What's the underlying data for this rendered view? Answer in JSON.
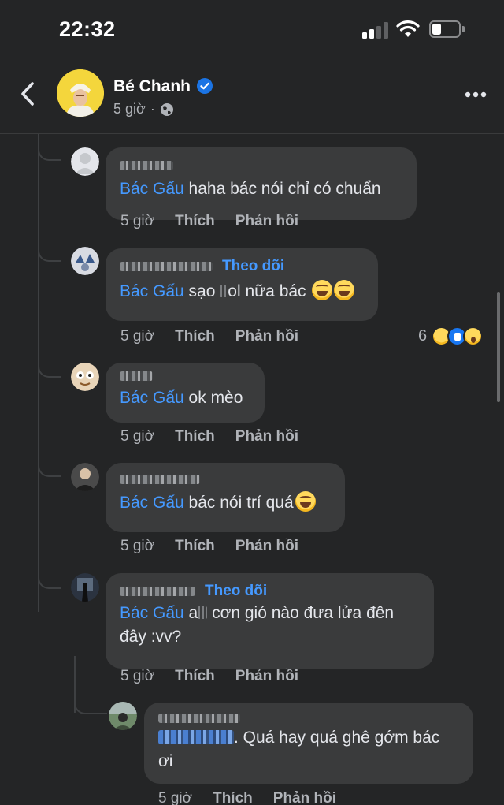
{
  "status_bar": {
    "time": "22:32"
  },
  "header": {
    "page_name": "Bé Chanh",
    "post_time": "5 giờ",
    "separator": "·"
  },
  "comments": [
    {
      "text_suffix": " haha bác nói chỉ có chuẩn",
      "mention": "Bác Gấu",
      "time": "5 giờ",
      "like": "Thích",
      "reply": "Phản hồi"
    },
    {
      "follow": "Theo dõi",
      "mention": "Bác Gấu",
      "text_part1": " sạo",
      "text_part2": "ol nữa bác ",
      "time": "5 giờ",
      "like": "Thích",
      "reply": "Phản hồi",
      "reaction_count": "6"
    },
    {
      "mention": "Bác Gấu",
      "text_suffix": " ok mèo",
      "time": "5 giờ",
      "like": "Thích",
      "reply": "Phản hồi"
    },
    {
      "mention": "Bác Gấu",
      "text_suffix": " bác nói trí quá",
      "time": "5 giờ",
      "like": "Thích",
      "reply": "Phản hồi"
    },
    {
      "follow": "Theo dõi",
      "mention": "Bác Gấu",
      "text_part1": " a",
      "text_part2": " cơn gió nào đưa lửa đên",
      "text_line2": "đây :vv?",
      "time": "5 giờ",
      "like": "Thích",
      "reply": "Phản hồi"
    },
    {
      "text_line1": ". Quá hay quá ghê gớm bác",
      "text_line2": "ơi",
      "time": "5 giờ",
      "like": "Thích",
      "reply": "Phản hồi"
    }
  ],
  "colors": {
    "background": "#242526",
    "bubble": "#3a3b3c",
    "link_blue": "#4599ff",
    "secondary_text": "#b0b3b8"
  }
}
